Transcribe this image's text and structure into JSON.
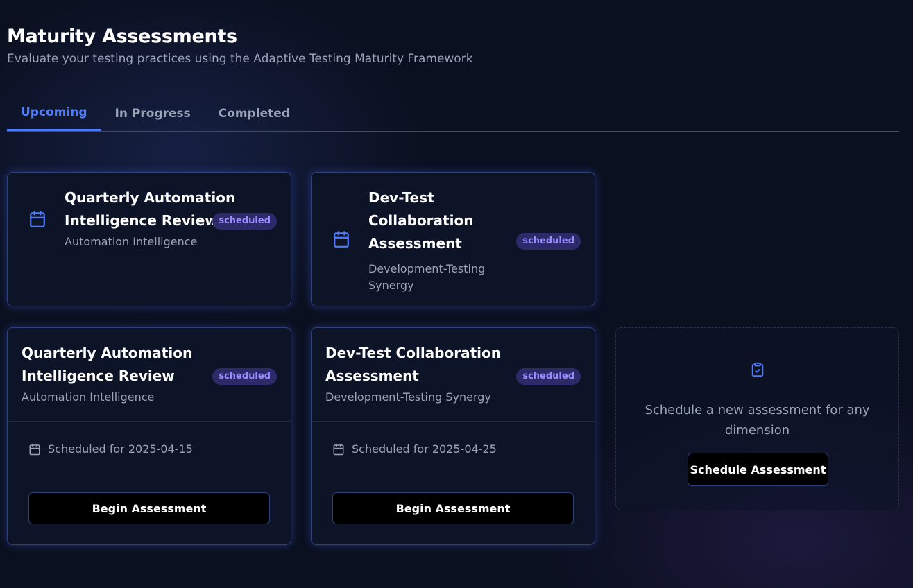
{
  "header": {
    "title": "Maturity Assessments",
    "subtitle": "Evaluate your testing practices using the Adaptive Testing Maturity Framework"
  },
  "tabs": [
    {
      "label": "Upcoming",
      "active": true
    },
    {
      "label": "In Progress",
      "active": false
    },
    {
      "label": "Completed",
      "active": false
    }
  ],
  "cards": [
    {
      "title_lines": [
        "Quarterly Automation",
        "Intelligence Review"
      ],
      "dimension": "Automation Intelligence",
      "status": "scheduled"
    },
    {
      "title_lines": [
        "Dev-Test",
        "Collaboration",
        "Assessment"
      ],
      "dimension_lines": [
        "Development-Testing",
        "Synergy"
      ],
      "status": "scheduled"
    },
    {
      "title_lines": [
        "Quarterly Automation",
        "Intelligence Review"
      ],
      "dimension": "Automation Intelligence",
      "status": "scheduled",
      "scheduled_text": "Scheduled for 2025-04-15",
      "action_label": "Begin Assessment"
    },
    {
      "title_lines": [
        "Dev-Test Collaboration",
        "Assessment"
      ],
      "dimension": "Development-Testing Synergy",
      "status": "scheduled",
      "scheduled_text": "Scheduled for 2025-04-25",
      "action_label": "Begin Assessment"
    }
  ],
  "new_assessment": {
    "text": "Schedule a new assessment for any dimension",
    "button_label": "Schedule Assessment"
  },
  "colors": {
    "accent": "#4f7cff",
    "badge_bg": "#2d2a6a",
    "badge_text": "#9a8cff",
    "background": "#0b1020"
  },
  "icons": {
    "card_icon": "calendar-icon",
    "new_assessment_icon": "clipboard-check-icon"
  }
}
